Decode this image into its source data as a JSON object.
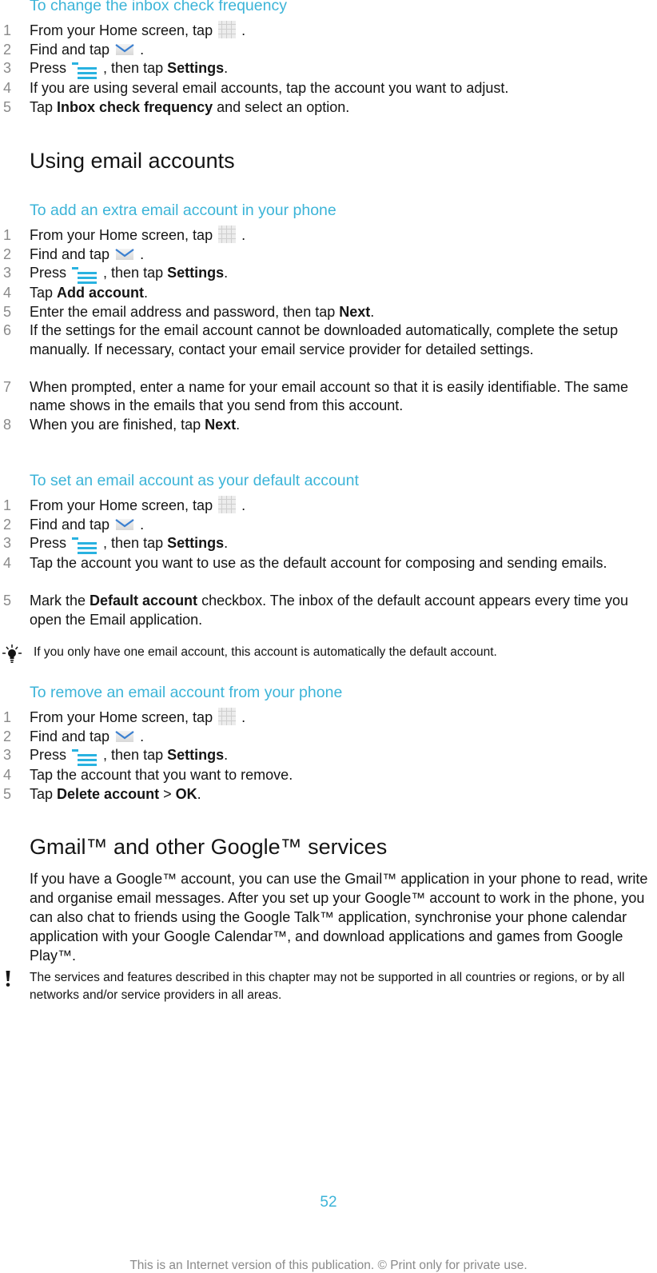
{
  "sections": {
    "inbox_frequency": {
      "title": "To change the inbox check frequency",
      "steps": [
        {
          "num": "1",
          "pre": "From your Home screen, tap ",
          "icon": "apps-grid-icon",
          "post": "."
        },
        {
          "num": "2",
          "pre": "Find and tap ",
          "icon": "email-icon",
          "post": "."
        },
        {
          "num": "3",
          "pre": "Press ",
          "icon": "menu-icon",
          "mid": ", then tap ",
          "bold": "Settings",
          "post": "."
        },
        {
          "num": "4",
          "text": "If you are using several email accounts, tap the account you want to adjust."
        },
        {
          "num": "5",
          "pre": "Tap ",
          "bold": "Inbox check frequency",
          "post": " and select an option."
        }
      ]
    },
    "using_accounts": {
      "heading": "Using email accounts"
    },
    "add_account": {
      "title": "To add an extra email account in your phone",
      "steps": [
        {
          "num": "1",
          "pre": "From your Home screen, tap ",
          "icon": "apps-grid-icon",
          "post": "."
        },
        {
          "num": "2",
          "pre": "Find and tap ",
          "icon": "email-icon",
          "post": "."
        },
        {
          "num": "3",
          "pre": "Press ",
          "icon": "menu-icon",
          "mid": ", then tap ",
          "bold": "Settings",
          "post": "."
        },
        {
          "num": "4",
          "pre": "Tap ",
          "bold": "Add account",
          "post": "."
        },
        {
          "num": "5",
          "pre": "Enter the email address and password, then tap ",
          "bold": "Next",
          "post": "."
        },
        {
          "num": "6",
          "text": "If the settings for the email account cannot be downloaded automatically, complete the setup manually. If necessary, contact your email service provider for detailed settings."
        },
        {
          "num": "7",
          "text": "When prompted, enter a name for your email account so that it is easily identifiable. The same name shows in the emails that you send from this account."
        },
        {
          "num": "8",
          "pre": "When you are finished, tap ",
          "bold": "Next",
          "post": "."
        }
      ]
    },
    "default_account": {
      "title": "To set an email account as your default account",
      "steps": [
        {
          "num": "1",
          "pre": "From your Home screen, tap ",
          "icon": "apps-grid-icon",
          "post": "."
        },
        {
          "num": "2",
          "pre": "Find and tap ",
          "icon": "email-icon",
          "post": "."
        },
        {
          "num": "3",
          "pre": "Press ",
          "icon": "menu-icon",
          "mid": ", then tap ",
          "bold": "Settings",
          "post": "."
        },
        {
          "num": "4",
          "text": "Tap the account you want to use as the default account for composing and sending emails."
        },
        {
          "num": "5",
          "pre": "Mark the ",
          "bold": "Default account",
          "post": " checkbox. The inbox of the default account appears every time you open the Email application."
        }
      ],
      "tip": "If you only have one email account, this account is automatically the default account."
    },
    "remove_account": {
      "title": "To remove an email account from your phone",
      "steps": [
        {
          "num": "1",
          "pre": "From your Home screen, tap ",
          "icon": "apps-grid-icon",
          "post": "."
        },
        {
          "num": "2",
          "pre": "Find and tap ",
          "icon": "email-icon",
          "post": "."
        },
        {
          "num": "3",
          "pre": "Press ",
          "icon": "menu-icon",
          "mid": ", then tap ",
          "bold": "Settings",
          "post": "."
        },
        {
          "num": "4",
          "text": "Tap the account that you want to remove."
        },
        {
          "num": "5",
          "pre": "Tap ",
          "bold": "Delete account",
          "mid2": " > ",
          "bold2": "OK",
          "post": "."
        }
      ]
    },
    "gmail": {
      "heading": "Gmail™ and other Google™ services",
      "paragraph": "If you have a Google™ account, you can use the Gmail™ application in your phone to read, write and organise email messages. After you set up your Google™ account to work in the phone, you can also chat to friends using the Google Talk™ application, synchronise your phone calendar application with your Google Calendar™, and download applications and games from Google Play™.",
      "warning": "The services and features described in this chapter may not be supported in all countries or regions, or by all networks and/or service providers in all areas."
    }
  },
  "footer": {
    "page_number": "52",
    "notice": "This is an Internet version of this publication. © Print only for private use."
  },
  "colors": {
    "accent": "#3cb4d8",
    "text": "#141414",
    "step_number": "#8a8a8a"
  }
}
